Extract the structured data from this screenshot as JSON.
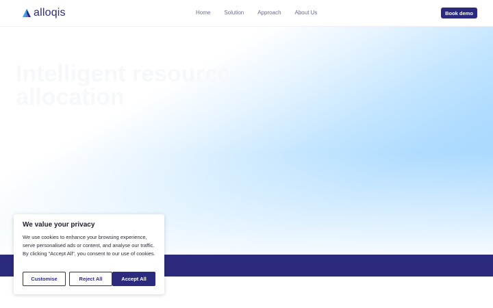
{
  "header": {
    "logo_text": "alloqis",
    "nav": [
      "Home",
      "Solution",
      "Approach",
      "About Us"
    ],
    "cta_label": "Book demo"
  },
  "hero": {
    "title": "Intelligent resource allocation"
  },
  "cookie": {
    "title": "We value your privacy",
    "body": "We use cookies to enhance your browsing experience, serve personalised ads or content, and analyse our traffic. By clicking \"Accept All\", you consent to our use of cookies.",
    "customise": "Customise",
    "reject": "Reject All",
    "accept": "Accept All"
  },
  "colors": {
    "brand": "#2b2a7d",
    "hero_blue": "#a4d6ff",
    "logo_accent": "#3aa0e8"
  },
  "icons": {
    "logo": "alloqis-triangle-logo-icon"
  }
}
